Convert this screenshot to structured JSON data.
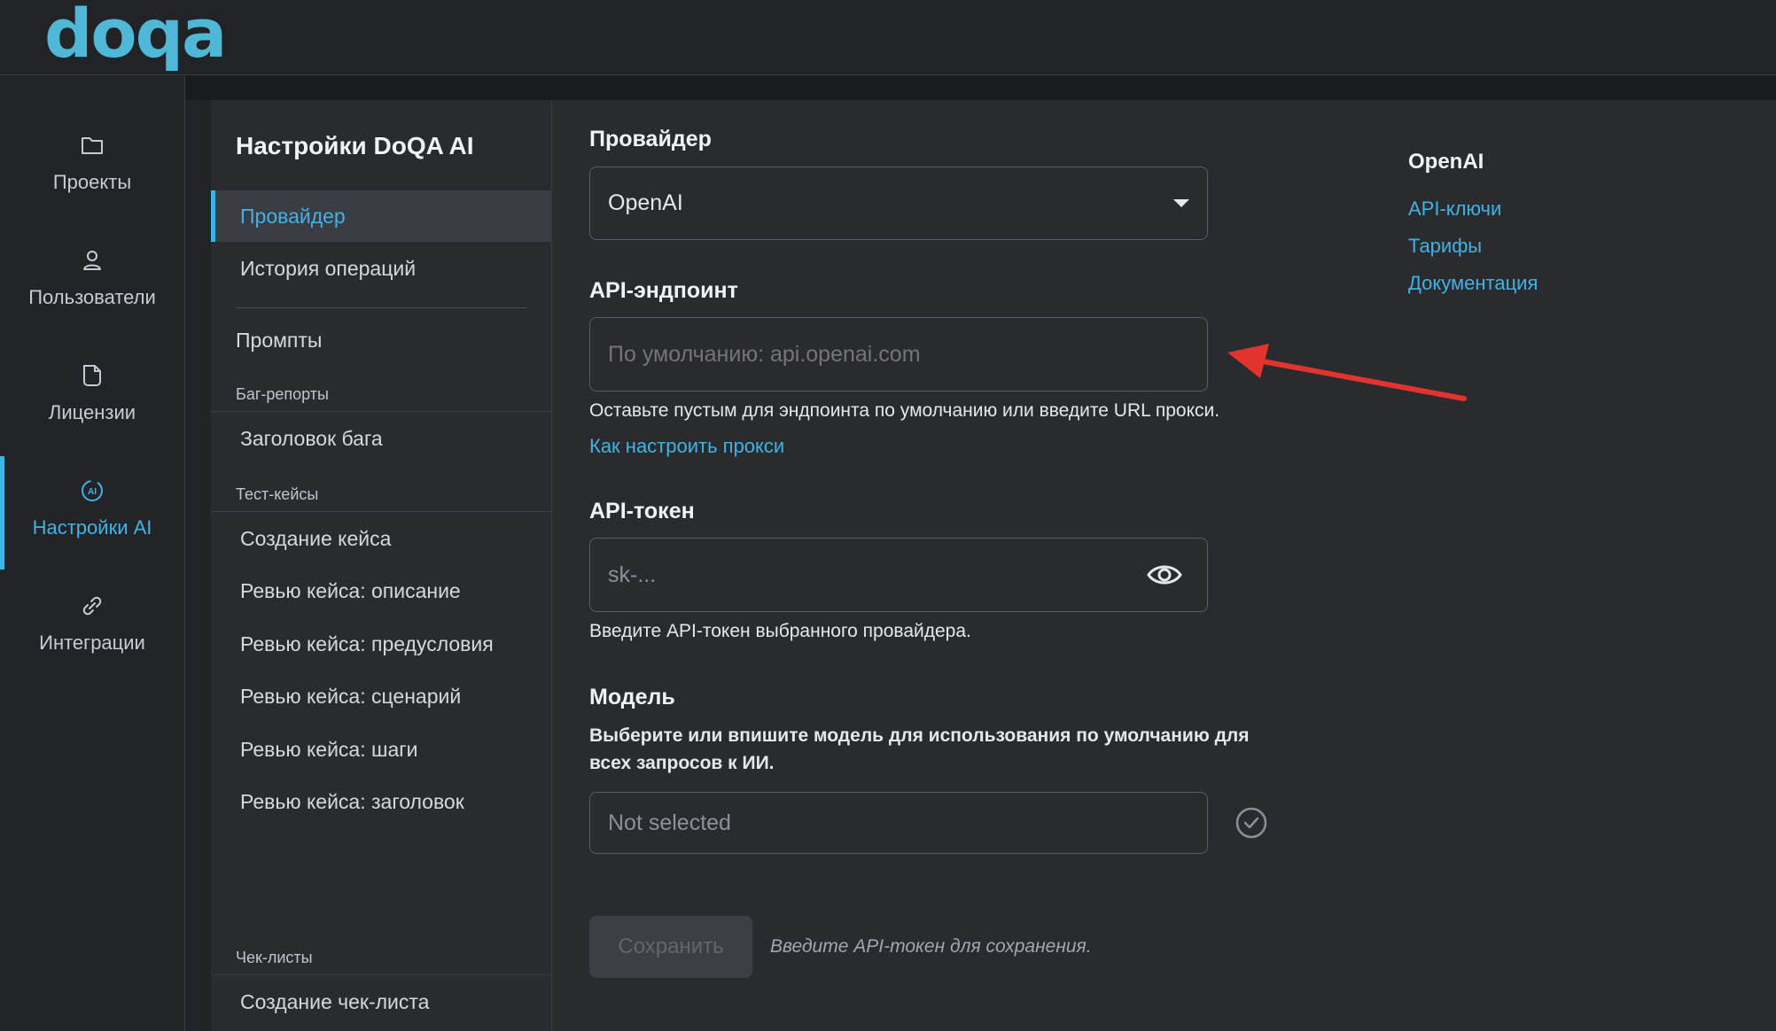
{
  "app": {
    "logo": "doqa"
  },
  "left_nav": {
    "items": [
      {
        "label": "Проекты",
        "icon": "folder-icon"
      },
      {
        "label": "Пользователи",
        "icon": "user-icon"
      },
      {
        "label": "Лицензии",
        "icon": "license-icon"
      },
      {
        "label": "Настройки AI",
        "icon": "ai-icon",
        "active": true
      },
      {
        "label": "Интеграции",
        "icon": "link-icon"
      }
    ]
  },
  "settings_nav": {
    "title": "Настройки DoQA AI",
    "provider": "Провайдер",
    "history": "История операций",
    "prompts": "Промпты",
    "bug_group": "Баг-репорты",
    "bug_title": "Заголовок бага",
    "testcase_group": "Тест-кейсы",
    "case_create": "Создание кейса",
    "review_description": "Ревью кейса: описание",
    "review_preconditions": "Ревью кейса: предусловия",
    "review_scenario": "Ревью кейса: сценарий",
    "review_steps": "Ревью кейса: шаги",
    "review_title": "Ревью кейса: заголовок",
    "checklist_group": "Чек-листы",
    "checklist_create": "Создание чек-листа"
  },
  "form": {
    "provider_label": "Провайдер",
    "provider_value": "OpenAI",
    "endpoint_label": "API-эндпоинт",
    "endpoint_placeholder": "По умолчанию: api.openai.com",
    "endpoint_hint": "Оставьте пустым для эндпоинта по умолчанию или введите URL прокси.",
    "proxy_link": "Как настроить прокси",
    "token_label": "API-токен",
    "token_placeholder": "sk-...",
    "token_hint": "Введите API-токен выбранного провайдера.",
    "model_label": "Модель",
    "model_hint_line1": "Выберите или впишите модель для использования по умолчанию для",
    "model_hint_line2": "всех запросов к ИИ.",
    "model_value": "Not selected",
    "save_label": "Сохранить",
    "save_hint": "Введите API-токен для сохранения."
  },
  "side_links": {
    "title": "OpenAI",
    "api_keys": "API-ключи",
    "pricing": "Тарифы",
    "docs": "Документация"
  },
  "colors": {
    "accent": "#3fb3e3",
    "logo": "#4fb8d6",
    "annotation_arrow": "#e0342c"
  }
}
